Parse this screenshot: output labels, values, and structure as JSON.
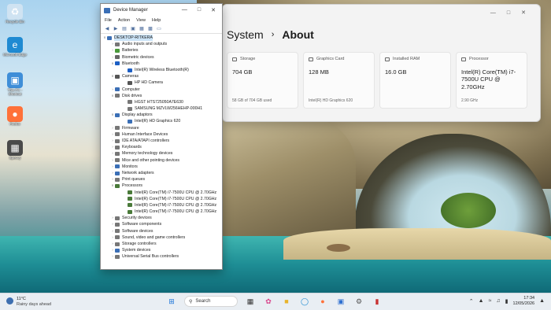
{
  "desktop": {
    "icons": [
      {
        "label": "Recycle Bin",
        "glyph": "♻",
        "color": "#cfe3f2"
      },
      {
        "label": "Microsoft Edge",
        "glyph": "e",
        "color": "#1f8ad2"
      },
      {
        "label": "This PC - Shortcut",
        "glyph": "▣",
        "color": "#3f8ed8"
      },
      {
        "label": "Firefox",
        "glyph": "●",
        "color": "#ff7139"
      },
      {
        "label": "Speccy",
        "glyph": "▦",
        "color": "#4a4a4a"
      }
    ]
  },
  "settings": {
    "breadcrumb_parent": "System",
    "breadcrumb_sep": "›",
    "breadcrumb_current": "About",
    "cards": [
      {
        "label": "Storage",
        "value": "704 GB",
        "sub": "58 GB of 704 GB used"
      },
      {
        "label": "Graphics Card",
        "value": "128 MB",
        "sub": "Intel(R) HD Graphics 620"
      },
      {
        "label": "Installed RAM",
        "value": "16.0 GB",
        "sub": ""
      },
      {
        "label": "Processor",
        "value": "Intel(R) Core(TM) i7-7500U CPU @ 2.70GHz",
        "sub": "2.90 GHz"
      }
    ]
  },
  "device_manager": {
    "title": "Device Manager",
    "menu": [
      "File",
      "Action",
      "View",
      "Help"
    ],
    "tree": [
      {
        "text": "DESKTOP-RITKERA",
        "level": 0,
        "exp": "∨",
        "color": "#3b6fb6",
        "selected": true
      },
      {
        "text": "Audio inputs and outputs",
        "level": 1,
        "exp": "›",
        "color": "#777"
      },
      {
        "text": "Batteries",
        "level": 1,
        "exp": "›",
        "color": "#4a9a3a"
      },
      {
        "text": "Biometric devices",
        "level": 1,
        "exp": "›",
        "color": "#666"
      },
      {
        "text": "Bluetooth",
        "level": 1,
        "exp": "∨",
        "color": "#1d5fc4"
      },
      {
        "text": "Intel(R) Wireless Bluetooth(R)",
        "level": 2,
        "exp": "",
        "color": "#1d5fc4"
      },
      {
        "text": "Cameras",
        "level": 1,
        "exp": "∨",
        "color": "#555"
      },
      {
        "text": "HP HD Camera",
        "level": 2,
        "exp": "",
        "color": "#555"
      },
      {
        "text": "Computer",
        "level": 1,
        "exp": "›",
        "color": "#3b6fb6"
      },
      {
        "text": "Disk drives",
        "level": 1,
        "exp": "∨",
        "color": "#777"
      },
      {
        "text": "HGST HTS725050A7E630",
        "level": 2,
        "exp": "",
        "color": "#777"
      },
      {
        "text": "SAMSUNG MZVLW256HEHP-000H1",
        "level": 2,
        "exp": "",
        "color": "#777"
      },
      {
        "text": "Display adaptors",
        "level": 1,
        "exp": "∨",
        "color": "#3b6fb6"
      },
      {
        "text": "Intel(R) HD Graphics 620",
        "level": 2,
        "exp": "",
        "color": "#3b6fb6"
      },
      {
        "text": "Firmware",
        "level": 1,
        "exp": "›",
        "color": "#777"
      },
      {
        "text": "Human Interface Devices",
        "level": 1,
        "exp": "›",
        "color": "#777"
      },
      {
        "text": "IDE ATA/ATAPI controllers",
        "level": 1,
        "exp": "›",
        "color": "#777"
      },
      {
        "text": "Keyboards",
        "level": 1,
        "exp": "›",
        "color": "#777"
      },
      {
        "text": "Memory technology devices",
        "level": 1,
        "exp": "›",
        "color": "#777"
      },
      {
        "text": "Mice and other pointing devices",
        "level": 1,
        "exp": "›",
        "color": "#777"
      },
      {
        "text": "Monitors",
        "level": 1,
        "exp": "›",
        "color": "#3b6fb6"
      },
      {
        "text": "Network adapters",
        "level": 1,
        "exp": "›",
        "color": "#3b6fb6"
      },
      {
        "text": "Print queues",
        "level": 1,
        "exp": "›",
        "color": "#777"
      },
      {
        "text": "Processors",
        "level": 1,
        "exp": "∨",
        "color": "#4a7a3a"
      },
      {
        "text": "Intel(R) Core(TM) i7-7500U CPU @ 2.70GHz",
        "level": 2,
        "exp": "",
        "color": "#4a7a3a"
      },
      {
        "text": "Intel(R) Core(TM) i7-7500U CPU @ 2.70GHz",
        "level": 2,
        "exp": "",
        "color": "#4a7a3a"
      },
      {
        "text": "Intel(R) Core(TM) i7-7500U CPU @ 2.70GHz",
        "level": 2,
        "exp": "",
        "color": "#4a7a3a"
      },
      {
        "text": "Intel(R) Core(TM) i7-7500U CPU @ 2.70GHz",
        "level": 2,
        "exp": "",
        "color": "#4a7a3a"
      },
      {
        "text": "Security devices",
        "level": 1,
        "exp": "›",
        "color": "#777"
      },
      {
        "text": "Software components",
        "level": 1,
        "exp": "›",
        "color": "#777"
      },
      {
        "text": "Software devices",
        "level": 1,
        "exp": "›",
        "color": "#777"
      },
      {
        "text": "Sound, video and game controllers",
        "level": 1,
        "exp": "›",
        "color": "#777"
      },
      {
        "text": "Storage controllers",
        "level": 1,
        "exp": "›",
        "color": "#777"
      },
      {
        "text": "System devices",
        "level": 1,
        "exp": "›",
        "color": "#3b6fb6"
      },
      {
        "text": "Universal Serial Bus controllers",
        "level": 1,
        "exp": "›",
        "color": "#777"
      }
    ]
  },
  "taskbar": {
    "weather_temp": "11°C",
    "weather_text": "Rainy days ahead",
    "search_placeholder": "Search",
    "time": "17:34",
    "date": "12/05/2026"
  }
}
